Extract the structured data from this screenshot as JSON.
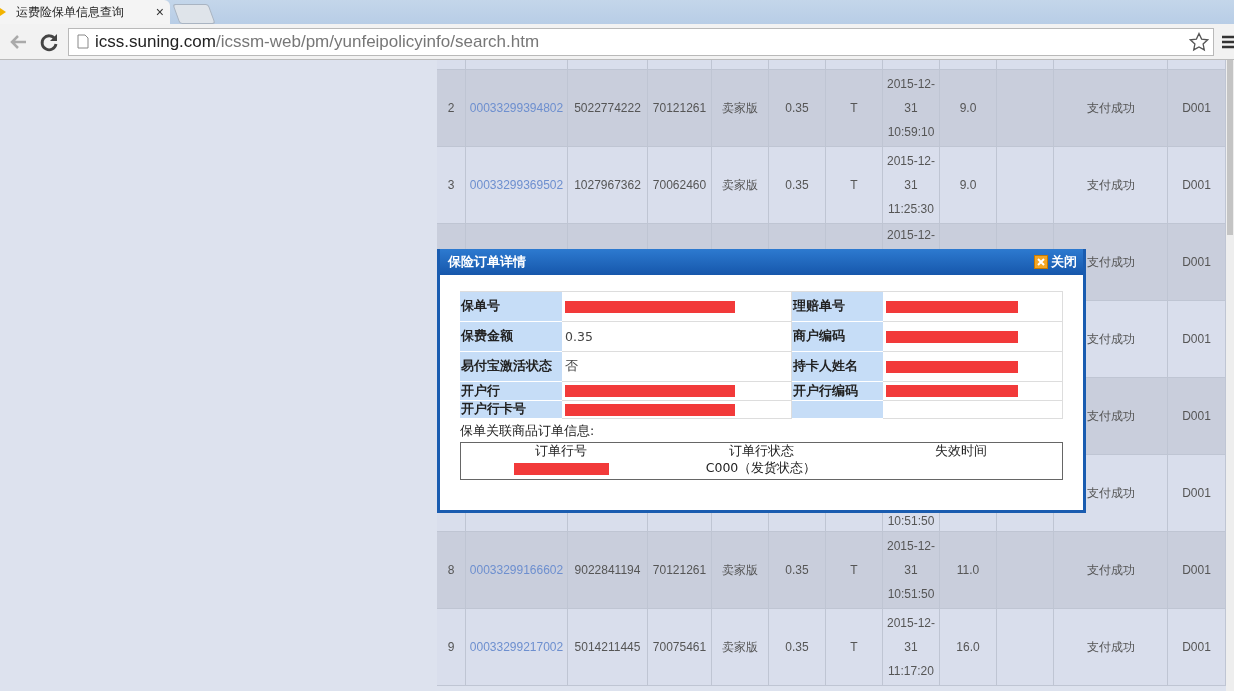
{
  "browser": {
    "tab": {
      "title": "运费险保单信息查询",
      "close": "×"
    },
    "address": {
      "host": "icss.suning.com",
      "path": "/icssm-web/pm/yunfeipolicyinfo/search.htm"
    }
  },
  "table": {
    "rows": [
      {
        "column_1": "2",
        "column_2": "00033299394802",
        "column_3": "5022774222",
        "column_4": "70121261",
        "column_5": "卖家版",
        "column_6": "0.35",
        "column_7": "T",
        "column_8": [
          "2015-12-",
          "31",
          "10:59:10"
        ],
        "column_9": "9.0",
        "column_11": "支付成功",
        "column_12": "D001"
      },
      {
        "column_1": "3",
        "column_2": "00033299369502",
        "column_3": "1027967362",
        "column_4": "70062460",
        "column_5": "卖家版",
        "column_6": "0.35",
        "column_7": "T",
        "column_8": [
          "2015-12-",
          "31",
          "11:25:30"
        ],
        "column_9": "9.0",
        "column_11": "支付成功",
        "column_12": "D001"
      },
      {
        "column_8": "2015-12-",
        "column_8_clipped_top": false,
        "column_11": "支付成功",
        "column_12": "D001"
      },
      {
        "column_11": "支付成功",
        "column_12": "D001"
      },
      {
        "column_11": "支付成功",
        "column_12": "D001"
      },
      {
        "column_8": "10:51:50",
        "column_8_clipped_top": true,
        "column_11": "支付成功",
        "column_12": "D001"
      },
      {
        "column_1": "8",
        "column_2": "00033299166602",
        "column_3": "9022841194",
        "column_4": "70121261",
        "column_5": "卖家版",
        "column_6": "0.35",
        "column_7": "T",
        "column_8": [
          "2015-12-",
          "31",
          "10:51:50"
        ],
        "column_9": "11.0",
        "column_11": "支付成功",
        "column_12": "D001"
      },
      {
        "column_1": "9",
        "column_2": "00033299217002",
        "column_3": "5014211445",
        "column_4": "70075461",
        "column_5": "卖家版",
        "column_6": "0.35",
        "column_7": "T",
        "column_8": [
          "2015-12-",
          "31",
          "11:17:20"
        ],
        "column_9": "16.0",
        "column_11": "支付成功",
        "column_12": "D001"
      }
    ]
  },
  "dialog": {
    "title": "保险订单详情",
    "close_label": "关闭",
    "fields": [
      {
        "left": {
          "label": "保单号",
          "value": {
            "kind": "redacted"
          }
        },
        "right": {
          "label": "理赔单号",
          "value": {
            "kind": "redacted"
          }
        }
      },
      {
        "left": {
          "label": "保费金额",
          "value": {
            "kind": "text",
            "text": "0.35"
          }
        },
        "right": {
          "label": "商户编码",
          "value": {
            "kind": "redacted"
          }
        }
      },
      {
        "left": {
          "label": "易付宝激活状态",
          "value": {
            "kind": "text",
            "text": "否"
          }
        },
        "right": {
          "label": "持卡人姓名",
          "value": {
            "kind": "redacted"
          }
        }
      },
      {
        "left": {
          "label": "开户行",
          "value": {
            "kind": "redacted"
          }
        },
        "right": {
          "label": "开户行编码",
          "value": {
            "kind": "redacted"
          }
        }
      },
      {
        "left": {
          "label": "开户行卡号",
          "value": {
            "kind": "redacted"
          }
        }
      }
    ],
    "section_title": "保单关联商品订单信息:",
    "order_table": {
      "columns": [
        "订单行号",
        "订单行状态",
        "失效时间"
      ],
      "rows": [
        [
          {
            "kind": "redacted"
          },
          {
            "kind": "text",
            "text": "C000（发货状态）"
          }
        ]
      ]
    }
  }
}
